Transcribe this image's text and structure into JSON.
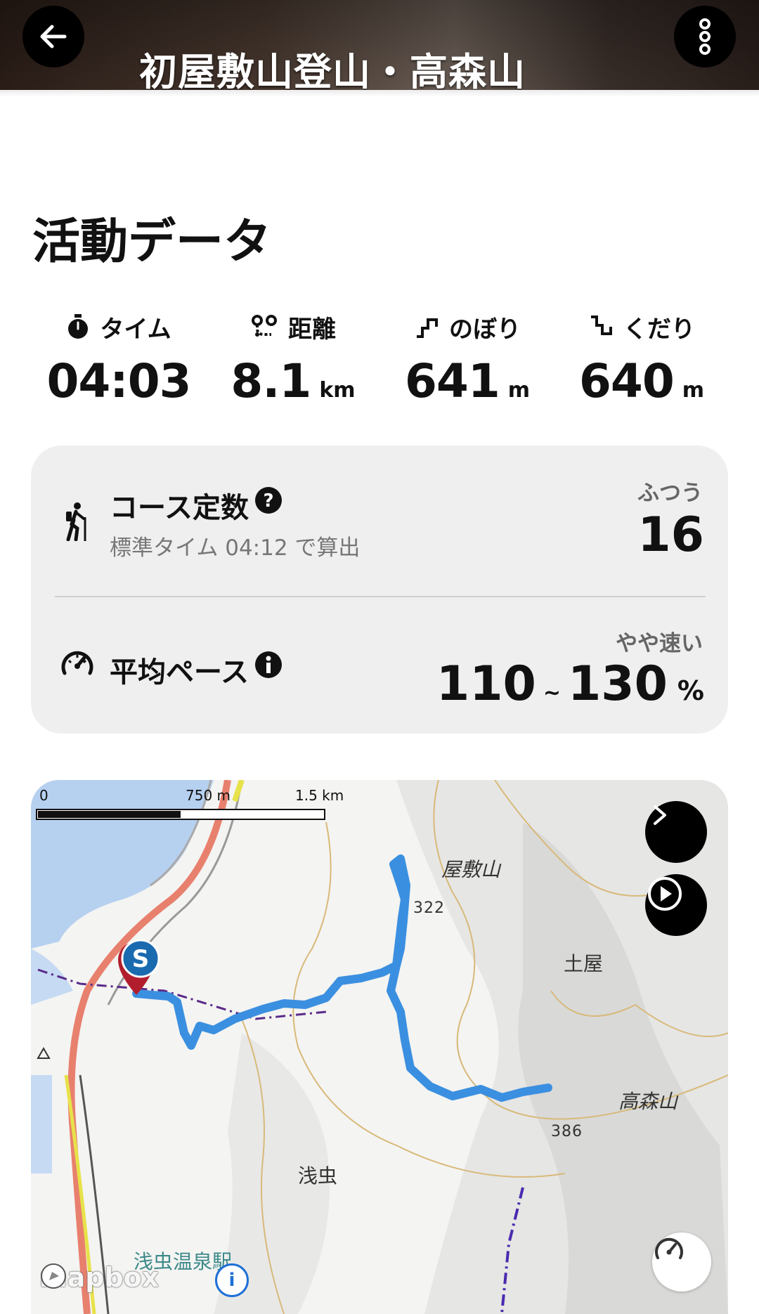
{
  "header": {
    "title": "初屋敷山登山・高森山",
    "back_icon": "arrow-left-icon",
    "menu_icon": "more-vertical-icon"
  },
  "activity": {
    "section_title": "活動データ",
    "stats": [
      {
        "icon": "stopwatch-icon",
        "label": "タイム",
        "value": "04:03",
        "unit": ""
      },
      {
        "icon": "route-distance-icon",
        "label": "距離",
        "value": "8.1",
        "unit": "km"
      },
      {
        "icon": "ascent-icon",
        "label": "のぼり",
        "value": "641",
        "unit": "m"
      },
      {
        "icon": "descent-icon",
        "label": "くだり",
        "value": "640",
        "unit": "m"
      }
    ]
  },
  "course": {
    "label": "コース定数",
    "sub": "標準タイム 04:12 で算出",
    "rating": "ふつう",
    "value": "16",
    "icon": "hiker-icon",
    "help_icon": "question-circle-icon"
  },
  "pace": {
    "label": "平均ペース",
    "rating": "やや速い",
    "min": "110",
    "sep": "~",
    "max": "130",
    "unit": "%",
    "icon": "speedometer-icon",
    "info_icon": "info-circle-icon"
  },
  "map": {
    "scale_labels": [
      "0",
      "750 m",
      "1.5 km"
    ],
    "places": [
      "屋敷山",
      "土屋",
      "高森山",
      "浅虫",
      "浅虫温泉駅"
    ],
    "elevations": [
      "322",
      "386"
    ],
    "start_marker": "S",
    "attribution": "mapbox",
    "route_color": "#3b8fe0",
    "buttons": [
      "chevron-right-icon",
      "play-circle-icon",
      "speedometer-icon"
    ]
  }
}
